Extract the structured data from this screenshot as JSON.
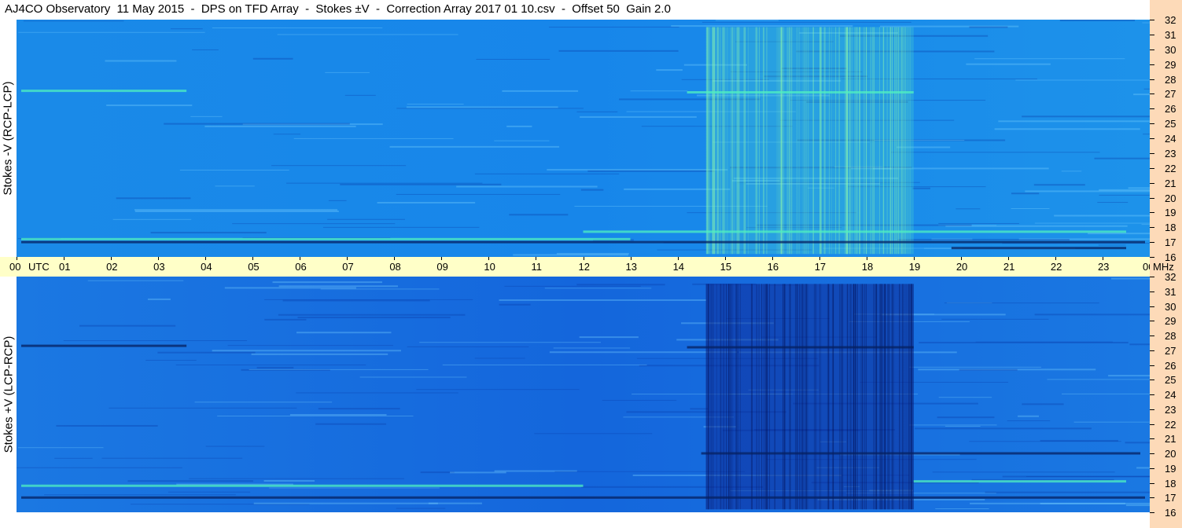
{
  "title": "AJ4CO Observatory  11 May 2015  -  DPS on TFD Array  -  Stokes ±V  -  Correction Array 2017 01 10.csv  -  Offset 50  Gain 2.0",
  "colors": {
    "time_axis_bg": "#ffffc8",
    "freq_axis_bg": "#fddab8",
    "top_panel_base": "#1a8ae8",
    "bottom_panel_base": "#1670de",
    "bright": "#4ff0c0",
    "dark": "#052060"
  },
  "chart_data": [
    {
      "type": "heatmap",
      "panel": "top",
      "ylabel": "Stokes -V (RCP-LCP)",
      "y_unit": "MHz",
      "ylim": [
        16,
        32
      ],
      "yticks": [
        16,
        17,
        18,
        19,
        20,
        21,
        22,
        23,
        24,
        25,
        26,
        27,
        28,
        29,
        30,
        31,
        32
      ],
      "x_unit": "UTC",
      "xlim": [
        0,
        24
      ],
      "xticks": [
        "00",
        "01",
        "02",
        "03",
        "04",
        "05",
        "06",
        "07",
        "08",
        "09",
        "10",
        "11",
        "12",
        "13",
        "14",
        "15",
        "16",
        "17",
        "18",
        "19",
        "20",
        "21",
        "22",
        "23",
        "00"
      ],
      "features": [
        {
          "kind": "bright_region",
          "x": [
            14.6,
            19.0
          ],
          "y": [
            16.2,
            31.5
          ]
        },
        {
          "kind": "bright_band",
          "x": [
            0.1,
            3.6
          ],
          "y": 27.2
        },
        {
          "kind": "bright_band",
          "x": [
            14.2,
            19.0
          ],
          "y": 27.1
        },
        {
          "kind": "bright_band",
          "x": [
            12.0,
            23.5
          ],
          "y": 17.7
        },
        {
          "kind": "bright_band",
          "x": [
            0.1,
            13.0
          ],
          "y": 17.2
        },
        {
          "kind": "dark_band",
          "x": [
            0.1,
            23.9
          ],
          "y": 17.0
        },
        {
          "kind": "dark_band",
          "x": [
            19.8,
            23.5
          ],
          "y": 16.6
        }
      ]
    },
    {
      "type": "heatmap",
      "panel": "bottom",
      "ylabel": "Stokes +V (LCP-RCP)",
      "y_unit": "MHz",
      "ylim": [
        16,
        32
      ],
      "yticks": [
        16,
        17,
        18,
        19,
        20,
        21,
        22,
        23,
        24,
        25,
        26,
        27,
        28,
        29,
        30,
        31,
        32
      ],
      "x_unit": "UTC",
      "xlim": [
        0,
        24
      ],
      "xticks": [
        "00",
        "01",
        "02",
        "03",
        "04",
        "05",
        "06",
        "07",
        "08",
        "09",
        "10",
        "11",
        "12",
        "13",
        "14",
        "15",
        "16",
        "17",
        "18",
        "19",
        "20",
        "21",
        "22",
        "23",
        "00"
      ],
      "features": [
        {
          "kind": "dark_region",
          "x": [
            14.6,
            19.0
          ],
          "y": [
            16.2,
            31.5
          ]
        },
        {
          "kind": "dark_band",
          "x": [
            0.1,
            3.6
          ],
          "y": 27.3
        },
        {
          "kind": "dark_band",
          "x": [
            14.2,
            19.0
          ],
          "y": 27.2
        },
        {
          "kind": "dark_band",
          "x": [
            0.1,
            23.9
          ],
          "y": 17.0
        },
        {
          "kind": "dark_band",
          "x": [
            14.5,
            23.8
          ],
          "y": 20.0
        },
        {
          "kind": "bright_band",
          "x": [
            0.1,
            12.0
          ],
          "y": 17.8
        },
        {
          "kind": "bright_band",
          "x": [
            19.0,
            23.5
          ],
          "y": 18.1
        }
      ]
    }
  ],
  "time_axis": {
    "labels": [
      "00",
      "01",
      "02",
      "03",
      "04",
      "05",
      "06",
      "07",
      "08",
      "09",
      "10",
      "11",
      "12",
      "13",
      "14",
      "15",
      "16",
      "17",
      "18",
      "19",
      "20",
      "21",
      "22",
      "23",
      "00"
    ],
    "start_unit": "UTC",
    "end_unit": "MHz"
  }
}
